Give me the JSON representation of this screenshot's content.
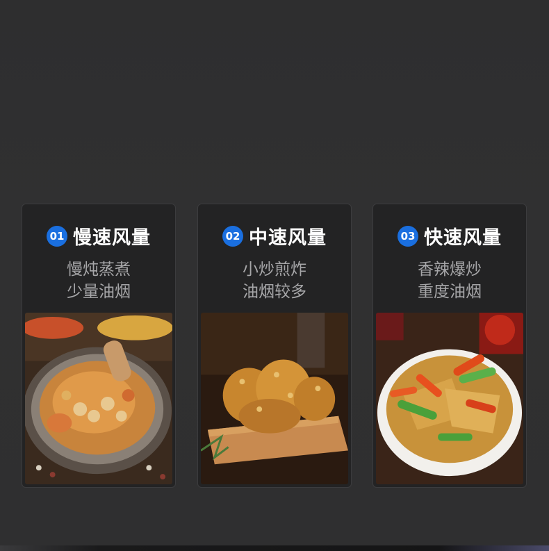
{
  "cards": [
    {
      "number": "01",
      "title": "慢速风量",
      "desc_line1": "慢炖蒸煮",
      "desc_line2": "少量油烟",
      "image": "soup-stew-photo"
    },
    {
      "number": "02",
      "title": "中速风量",
      "desc_line1": "小炒煎炸",
      "desc_line2": "油烟较多",
      "image": "fried-chicken-photo"
    },
    {
      "number": "03",
      "title": "快速风量",
      "desc_line1": "香辣爆炒",
      "desc_line2": "重度油烟",
      "image": "spicy-stirfry-photo"
    }
  ],
  "colors": {
    "badge": "#1a6fe0",
    "card_bg": "#232324",
    "page_bg": "#2f2f30"
  }
}
